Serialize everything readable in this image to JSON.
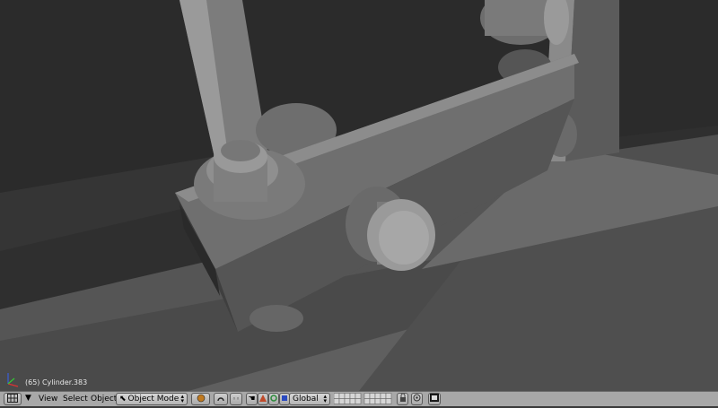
{
  "viewport": {
    "object_info": "(65) Cylinder.383"
  },
  "header": {
    "menus": {
      "view": "View",
      "select": "Select",
      "object": "Object"
    },
    "mode": "Object Mode",
    "orientation": "Global",
    "icons": [
      "editor-type-icon",
      "collapse-arrow-icon",
      "mode-icon",
      "shading-solid-icon",
      "pivot-icon",
      "proportional-edit-icon",
      "manipulator-hand-icon",
      "translate-icon",
      "rotate-icon",
      "scale-icon",
      "layer-grid",
      "lock-icon",
      "render-icon",
      "camera-render-icon"
    ]
  },
  "colors": {
    "header_bg": "#a8a8a8",
    "viewport_bg": "#2e2e2e"
  }
}
